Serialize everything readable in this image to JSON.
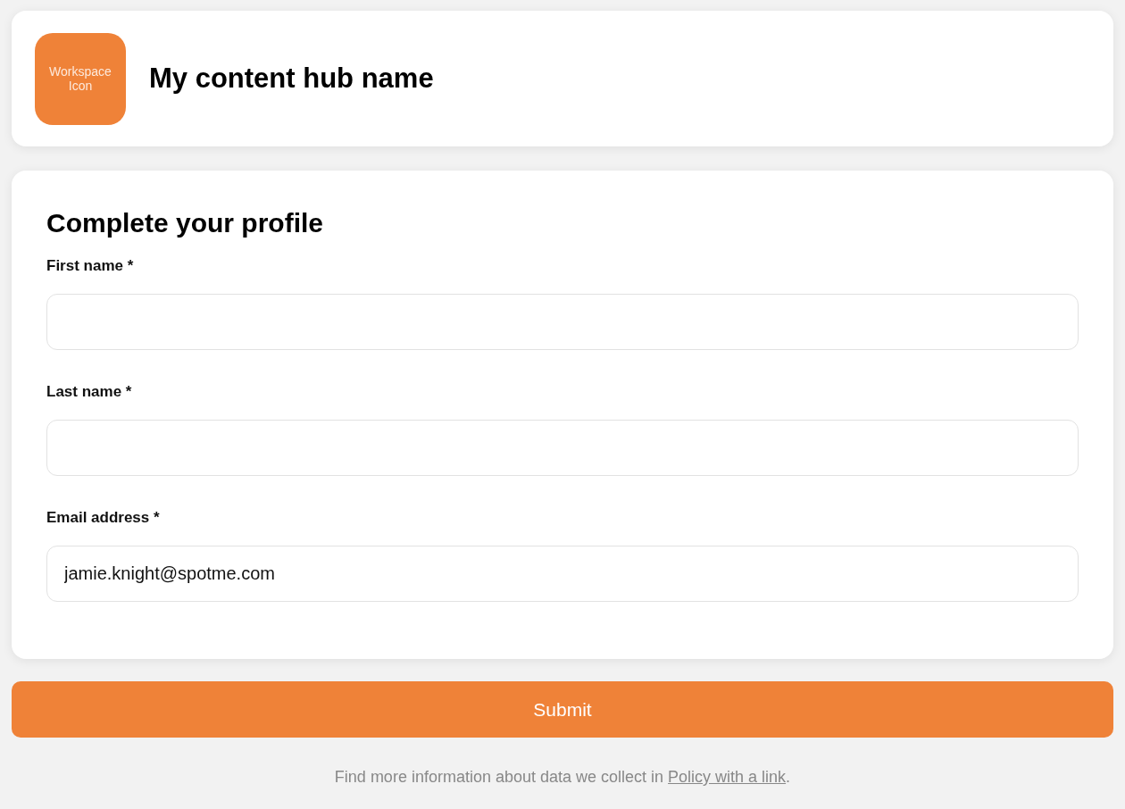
{
  "header": {
    "workspace_icon_text": "Workspace Icon",
    "hub_name": "My content hub name"
  },
  "form": {
    "title": "Complete your profile",
    "fields": [
      {
        "label": "First name *"
      },
      {
        "label": "Last name *"
      },
      {
        "label": "Email address *",
        "value": "jamie.knight@spotme.com"
      }
    ]
  },
  "submit_button": "Submit",
  "footer": {
    "text_before": "Find more information about data we collect in ",
    "link": "Policy with a link",
    "text_after": "."
  }
}
